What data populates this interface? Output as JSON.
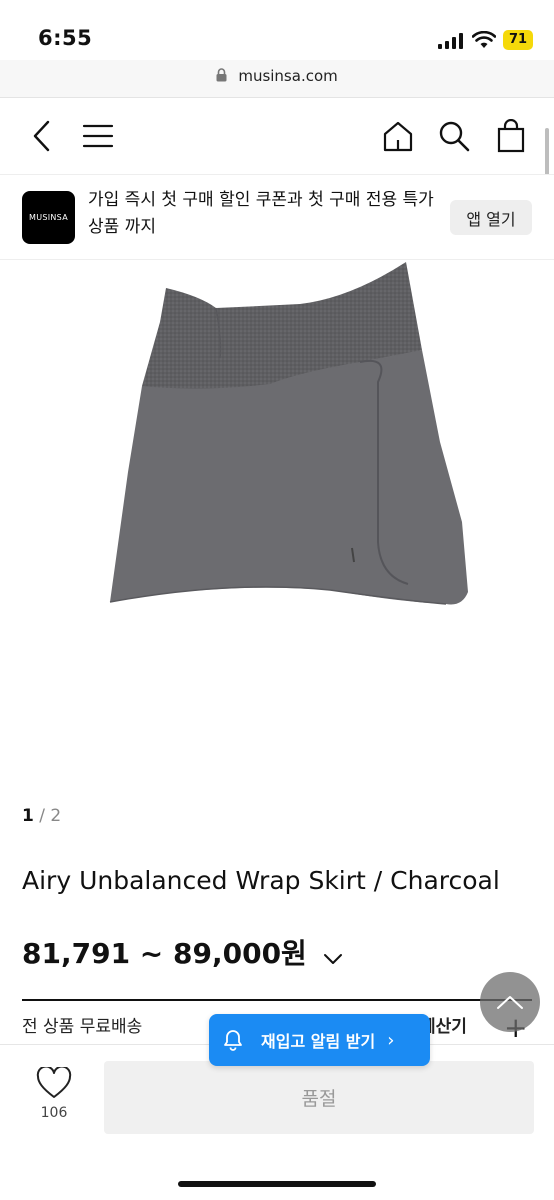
{
  "status_bar": {
    "time": "6:55",
    "battery": "71"
  },
  "browser": {
    "url": "musinsa.com"
  },
  "banner": {
    "logo_text": "MUSINSA",
    "message": "가입 즉시 첫 구매 할인 쿠폰과 첫 구매 전용 특가 상품 까지",
    "open_app_label": "앱 열기"
  },
  "gallery": {
    "current": "1",
    "separator": "/",
    "total": "2"
  },
  "product": {
    "title": "Airy Unbalanced Wrap Skirt / Charcoal",
    "price": "81,791 ~ 89,000원"
  },
  "shipping": {
    "label": "전 상품 무료배송",
    "calc_label": "계산기",
    "plus": "+"
  },
  "restock": {
    "label": "재입고 알림 받기",
    "arrow": "›"
  },
  "bottom_bar": {
    "like_count": "106",
    "soldout_label": "품절"
  }
}
